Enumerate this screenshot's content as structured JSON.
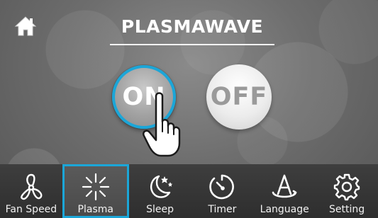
{
  "header": {
    "title": "PLASMAWAVE"
  },
  "power": {
    "on_label": "ON",
    "off_label": "OFF",
    "state": "on"
  },
  "tabs": [
    {
      "label": "Fan Speed",
      "icon": "fan-icon",
      "active": false
    },
    {
      "label": "Plasma",
      "icon": "plasma-icon",
      "active": true
    },
    {
      "label": "Sleep",
      "icon": "sleep-moon-icon",
      "active": false
    },
    {
      "label": "Timer",
      "icon": "timer-icon",
      "active": false
    },
    {
      "label": "Language",
      "icon": "language-icon",
      "active": false
    },
    {
      "label": "Setting",
      "icon": "gear-icon",
      "active": false
    }
  ],
  "colors": {
    "accent": "#1ba6d8",
    "tabbar": "#333333",
    "background": "#6e6e6e"
  }
}
